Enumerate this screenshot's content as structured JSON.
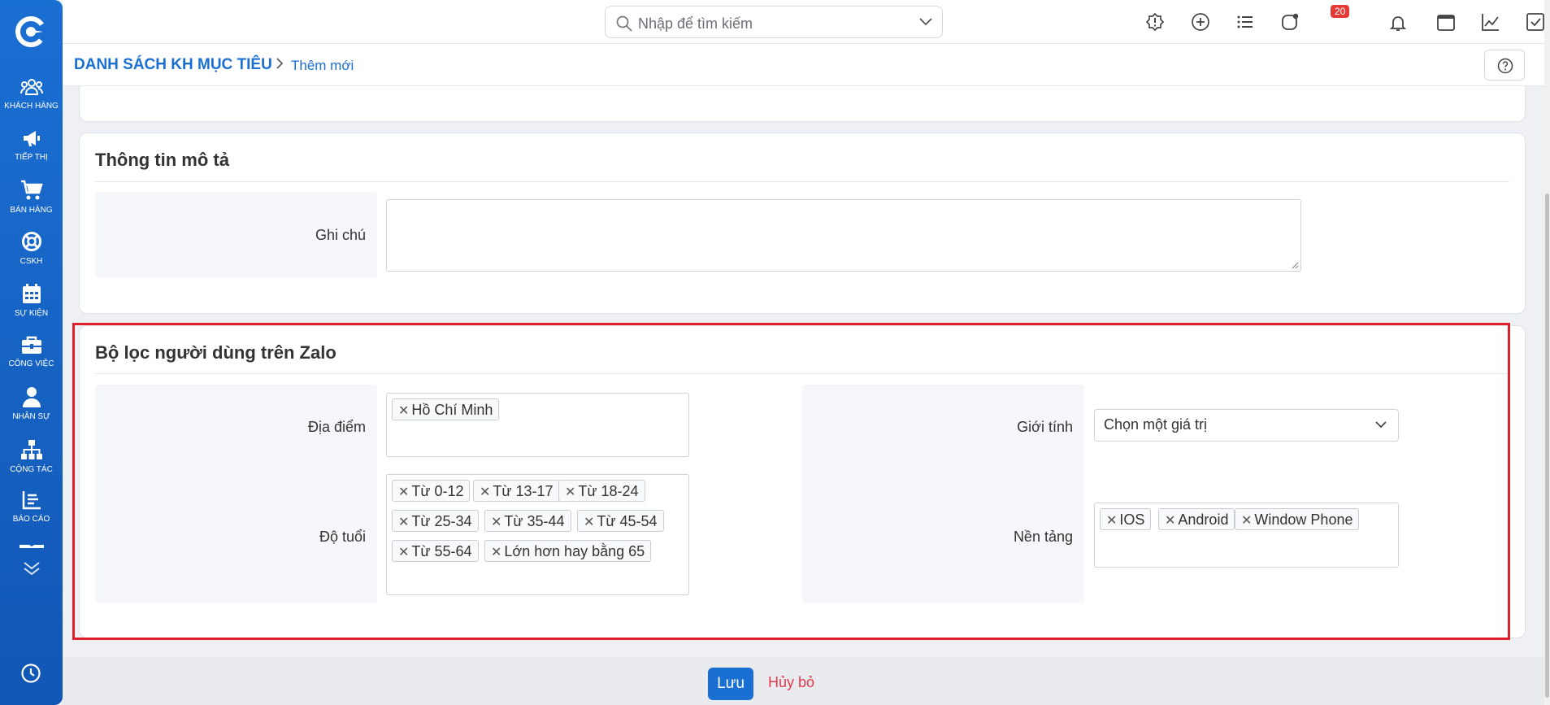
{
  "sidebar": {
    "items": [
      {
        "label": "KHÁCH HÀNG",
        "icon": "users-icon"
      },
      {
        "label": "TIẾP THỊ",
        "icon": "megaphone-icon"
      },
      {
        "label": "BÁN HÀNG",
        "icon": "cart-icon"
      },
      {
        "label": "CSKH",
        "icon": "lifebuoy-icon"
      },
      {
        "label": "SỰ KIỆN",
        "icon": "calendar-icon"
      },
      {
        "label": "CÔNG VIỆC",
        "icon": "briefcase-icon"
      },
      {
        "label": "NHÂN SỰ",
        "icon": "person-icon"
      },
      {
        "label": "CỘNG TÁC",
        "icon": "sitemap-icon"
      },
      {
        "label": "BÁO CÁO",
        "icon": "report-icon"
      }
    ]
  },
  "header": {
    "search_placeholder": "Nhập để tìm kiếm",
    "notification_count": "20"
  },
  "breadcrumb": {
    "parent": "DANH SÁCH KH MỤC TIÊU",
    "current": "Thêm mới"
  },
  "description_section": {
    "title": "Thông tin mô tả",
    "note_label": "Ghi chú",
    "note_value": ""
  },
  "zalo_filter": {
    "title": "Bộ lọc người dùng trên Zalo",
    "location_label": "Địa điểm",
    "location_tags": [
      "Hồ Chí Minh"
    ],
    "age_label": "Độ tuổi",
    "age_tags": [
      "Từ 0-12",
      "Từ 13-17",
      "Từ 18-24",
      "Từ 25-34",
      "Từ 35-44",
      "Từ 45-54",
      "Từ 55-64",
      "Lớn hơn hay bằng 65"
    ],
    "gender_label": "Giới tính",
    "gender_value": "Chọn một giá trị",
    "platform_label": "Nền tảng",
    "platform_tags": [
      "IOS",
      "Android",
      "Window Phone"
    ]
  },
  "footer": {
    "save_label": "Lưu",
    "cancel_label": "Hủy bỏ"
  },
  "colors": {
    "primary": "#1a6fd3",
    "highlight_border": "#e0202a",
    "badge": "#e53935",
    "cancel": "#e53950"
  }
}
